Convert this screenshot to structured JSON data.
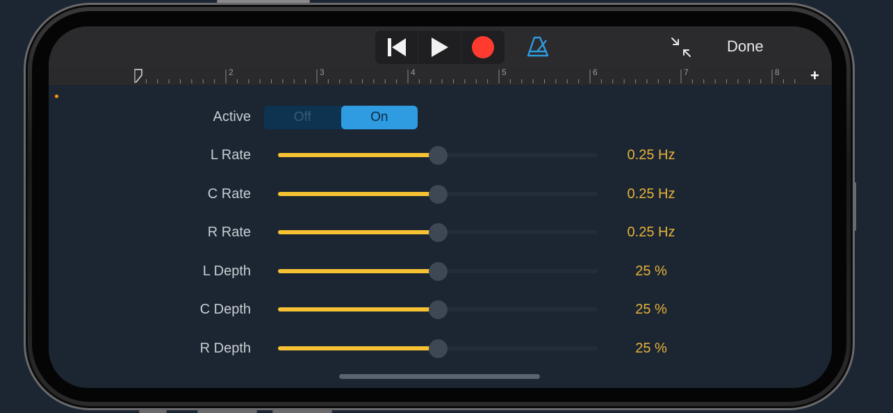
{
  "toolbar": {
    "transport": [
      "go-to-beginning",
      "play",
      "record"
    ],
    "metronome_icon": "metronome-icon",
    "collapse_icon": "collapse-icon",
    "done_label": "Done"
  },
  "ruler": {
    "bar_numbers": [
      "2",
      "3",
      "4",
      "5",
      "6",
      "7",
      "8"
    ],
    "add_label": "+"
  },
  "controls": {
    "active": {
      "label": "Active",
      "off_label": "Off",
      "on_label": "On",
      "selected": "On"
    },
    "params": [
      {
        "label": "L Rate",
        "value": "0.25 Hz",
        "position": 0.5
      },
      {
        "label": "C Rate",
        "value": "0.25 Hz",
        "position": 0.5
      },
      {
        "label": "R Rate",
        "value": "0.25 Hz",
        "position": 0.5
      },
      {
        "label": "L Depth",
        "value": "25 %",
        "position": 0.5
      },
      {
        "label": "C Depth",
        "value": "25 %",
        "position": 0.5
      },
      {
        "label": "R Depth",
        "value": "25 %",
        "position": 0.5
      }
    ]
  },
  "colors": {
    "accent_blue": "#2f9be0",
    "slider_yellow": "#f6c233",
    "value_text": "#e6b23a",
    "record_red": "#ff3b30",
    "background": "#1c2632"
  }
}
